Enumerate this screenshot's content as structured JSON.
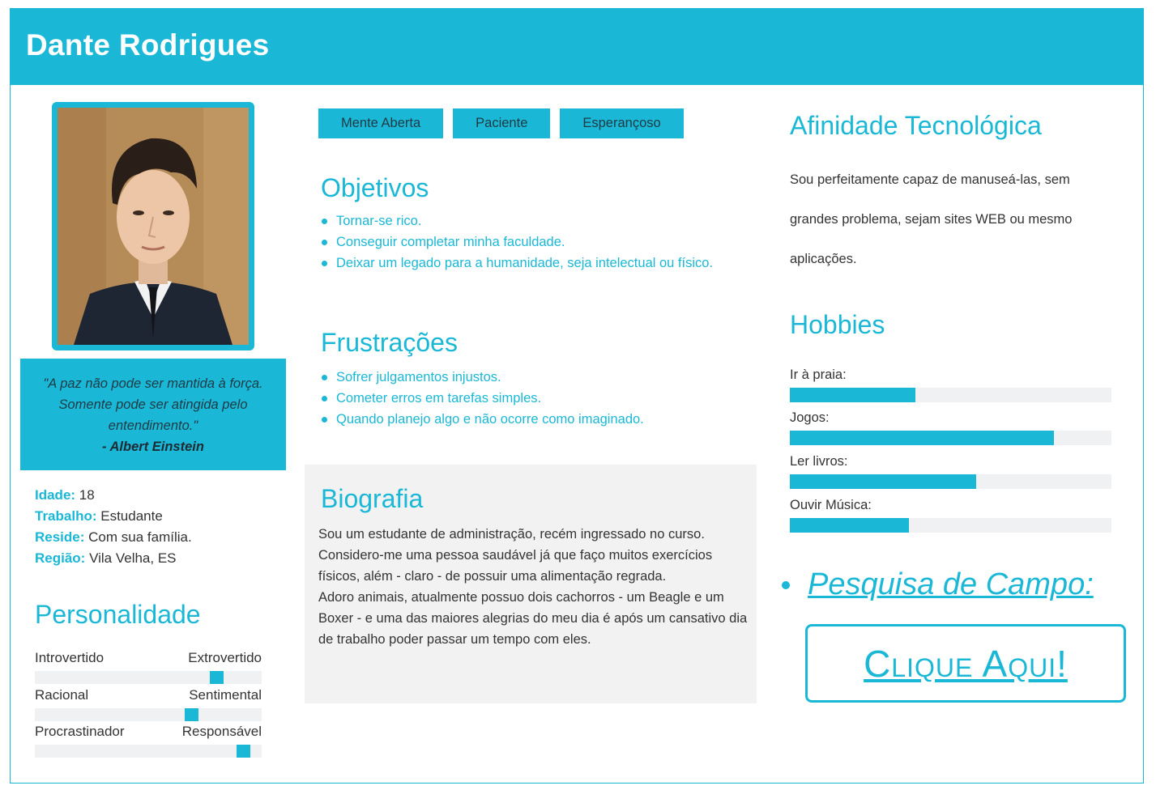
{
  "header": {
    "name": "Dante Rodrigues"
  },
  "quote": {
    "text": "\"A paz não pode ser mantida à força. Somente pode ser atingida pelo entendimento.\"",
    "author": "- Albert Einstein"
  },
  "facts": [
    {
      "key": "Idade:",
      "value": "18"
    },
    {
      "key": "Trabalho:",
      "value": "Estudante"
    },
    {
      "key": "Reside:",
      "value": "Com sua família."
    },
    {
      "key": "Região:",
      "value": "Vila Velha, ES"
    }
  ],
  "personality": {
    "title": "Personalidade",
    "traits": [
      {
        "left": "Introvertido",
        "right": "Extrovertido",
        "level": 0.8
      },
      {
        "left": "Racional",
        "right": "Sentimental",
        "level": 0.69
      },
      {
        "left": "Procrastinador",
        "right": "Responsável",
        "level": 0.92
      }
    ]
  },
  "tags": [
    "Mente Aberta",
    "Paciente",
    "Esperançoso"
  ],
  "goals": {
    "title": "Objetivos",
    "items": [
      "Tornar-se rico.",
      "Conseguir completar minha faculdade.",
      "Deixar um legado para a humanidade, seja intelectual ou físico."
    ]
  },
  "frustrations": {
    "title": "Frustrações",
    "items": [
      "Sofrer julgamentos injustos.",
      "Cometer erros em tarefas simples.",
      "Quando planejo algo e não ocorre como imaginado."
    ]
  },
  "bio": {
    "title": "Biografia",
    "text": "Sou um estudante de administração, recém ingressado no curso. Considero-me uma pessoa saudável já que faço muitos exercícios físicos, além - claro - de possuir uma alimentação regrada.\nAdoro animais, atualmente possuo dois cachorros - um Beagle e um Boxer - e uma das maiores alegrias do meu dia é após um cansativo dia de trabalho poder passar um tempo com eles."
  },
  "tech": {
    "title": "Afinidade Tecnológica",
    "text": "Sou perfeitamente capaz de manuseá-las, sem grandes problema, sejam sites WEB ou mesmo aplicações."
  },
  "hobbies": {
    "title": "Hobbies",
    "items": [
      {
        "label": "Ir à praia:",
        "level": 0.39
      },
      {
        "label": "Jogos:",
        "level": 0.82
      },
      {
        "label": "Ler livros:",
        "level": 0.58
      },
      {
        "label": "Ouvir Música:",
        "level": 0.37
      }
    ]
  },
  "research": {
    "label": "Pesquisa de Campo:",
    "button": "Clique Aqui!"
  },
  "colors": {
    "accent": "#1ab8d6",
    "track": "#f0f1f3",
    "bio_bg": "#f2f2f2"
  }
}
